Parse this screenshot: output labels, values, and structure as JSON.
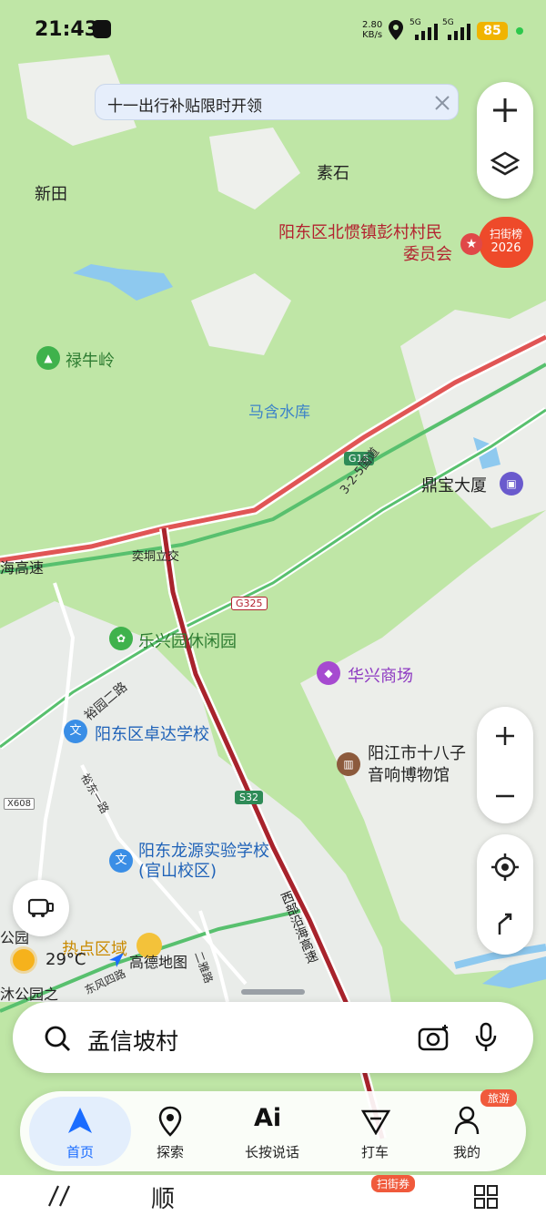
{
  "status": {
    "time": "21:43",
    "net_speed": "2.80",
    "net_unit": "KB/s",
    "sim1": "5G",
    "sim2": "5G",
    "battery": "85"
  },
  "banner": {
    "text": "十一出行补贴限时开领"
  },
  "hot_badge": {
    "line1": "扫街榜",
    "line2": "2026"
  },
  "map": {
    "places": [
      "素石",
      "新田",
      "阳东区北惯镇彭村村民",
      "委员会",
      "禄牛岭",
      "马含水库",
      "鼎宝大厦",
      "奕垌立交",
      "海高速",
      "乐兴园休闲园",
      "华兴商场",
      "裕园二路",
      "阳东区卓达学校",
      "阳江市十八子",
      "音响博物馆",
      "裕东一路",
      "阳东龙源实验学校",
      "(官山校区)",
      "西部沿海高速",
      "热点区域",
      "二雅路",
      "东风四路",
      "公园",
      "沐公园之"
    ],
    "roads": [
      "G15",
      "3-2-5国道",
      "G325",
      "S32",
      "X608"
    ],
    "weather": "29°C",
    "brand": "高德地图"
  },
  "search": {
    "value": "孟信坡村"
  },
  "tabs": [
    {
      "label": "首页"
    },
    {
      "label": "探索"
    },
    {
      "label": "长按说话"
    },
    {
      "label": "打车"
    },
    {
      "label": "我的"
    }
  ],
  "trip_badge": "旅游",
  "bottom": {
    "coupon": "扫街券",
    "shun": "顺"
  },
  "colors": {
    "accent": "#1a6cff",
    "map_green": "#bfe6a6",
    "highway_red": "#e05555"
  }
}
